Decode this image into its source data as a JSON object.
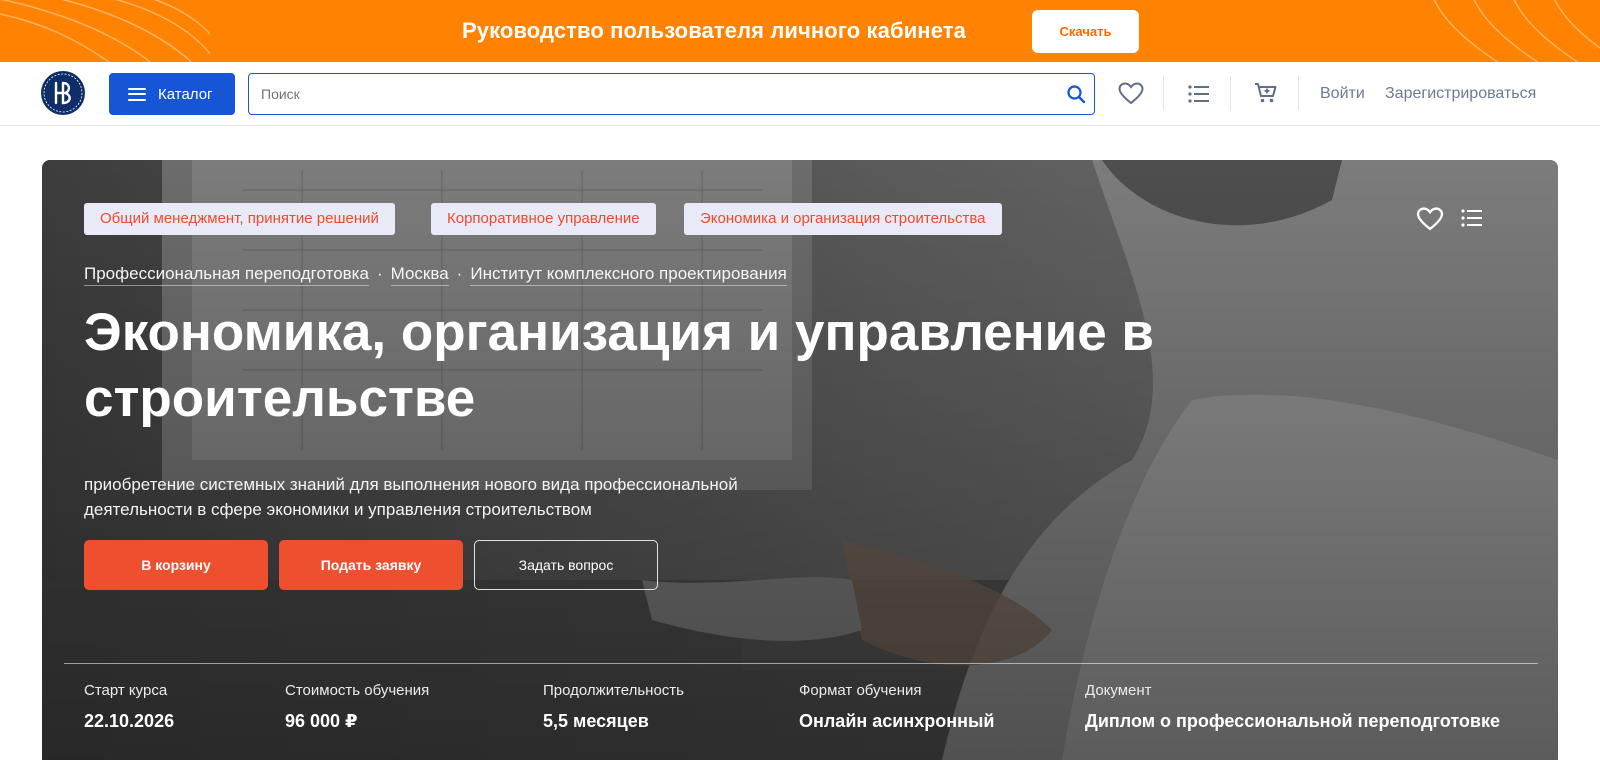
{
  "promo": {
    "text": "Руководство пользователя личного кабинета",
    "button_label": "Скачать"
  },
  "header": {
    "catalog_label": "Каталог",
    "search_placeholder": "Поиск",
    "login_label": "Войти",
    "register_label": "Зарегистрироваться",
    "icons": [
      "search-icon",
      "heart-icon",
      "list-icon",
      "cart-icon"
    ]
  },
  "hero": {
    "tags": [
      "Общий менеджмент, принятие решений",
      "Корпоративное управление",
      "Экономика и организация строительства"
    ],
    "breadcrumbs": [
      "Профессиональная переподготовка",
      "Москва",
      "Институт комплексного проектирования"
    ],
    "title": "Экономика, организация и управление в строительстве",
    "subtitle": "приобретение системных знаний для выполнения нового вида профессиональной деятельности в сфере экономики и управления строительством",
    "buttons": {
      "cart": "В корзину",
      "apply": "Подать заявку",
      "ask": "Задать вопрос"
    },
    "info": [
      {
        "label": "Старт курса",
        "value": "22.10.2026"
      },
      {
        "label": "Стоимость обучения",
        "value": "96 000 ₽"
      },
      {
        "label": "Продолжительность",
        "value": "5,5 месяцев"
      },
      {
        "label": "Формат обучения",
        "value": "Онлайн асинхронный"
      },
      {
        "label": "Документ",
        "value": "Диплом о профессиональной переподготовке"
      }
    ]
  },
  "colors": {
    "promo_bg": "#ff8300",
    "brand_blue": "#1656d6",
    "accent_red": "#ee4f2f",
    "tag_bg": "#e8eaf7",
    "logo_navy": "#0f2d69"
  }
}
